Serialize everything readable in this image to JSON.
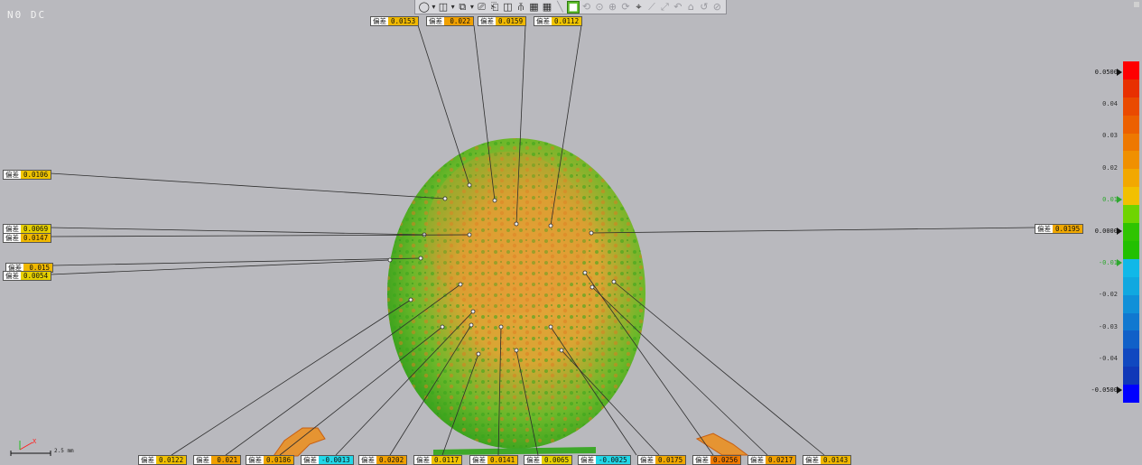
{
  "hud": {
    "text": "N0  DC"
  },
  "toolbar": {
    "buttons": [
      {
        "name": "view-sphere-icon",
        "glyph": "◯"
      },
      {
        "name": "dropdown-1-icon",
        "glyph": "▾",
        "small": true
      },
      {
        "name": "view-cube-icon",
        "glyph": "◫"
      },
      {
        "name": "dropdown-2-icon",
        "glyph": "▾",
        "small": true
      },
      {
        "name": "shade-icon",
        "glyph": "⧉"
      },
      {
        "name": "dropdown-3-icon",
        "glyph": "▾",
        "small": true
      },
      {
        "name": "front-view-icon",
        "glyph": "⎚"
      },
      {
        "name": "side-view-icon",
        "glyph": "⎗"
      },
      {
        "name": "split-view-icon",
        "glyph": "◫"
      },
      {
        "name": "align-icon",
        "glyph": "⫚"
      },
      {
        "name": "grid-table-icon",
        "glyph": "▦"
      },
      {
        "name": "grid-table-2-icon",
        "glyph": "▦"
      },
      {
        "name": "line-tool-icon",
        "glyph": "╲",
        "dim": true
      },
      {
        "name": "color-map-icon",
        "glyph": "■",
        "active": true
      },
      {
        "name": "rotate-icon",
        "glyph": "⟲",
        "dim": true
      },
      {
        "name": "zoom-icon",
        "glyph": "⊙",
        "dim": true
      },
      {
        "name": "pan-icon",
        "glyph": "⊕",
        "dim": true
      },
      {
        "name": "measure-icon",
        "glyph": "⟳",
        "dim": true
      },
      {
        "name": "probe-icon",
        "glyph": "⌖"
      },
      {
        "name": "section-icon",
        "glyph": "⟋",
        "dim": true
      },
      {
        "name": "fit-icon",
        "glyph": "⤢",
        "dim": true
      },
      {
        "name": "undo-icon",
        "glyph": "↶",
        "dim": true
      },
      {
        "name": "home-icon",
        "glyph": "⌂",
        "dim": true
      },
      {
        "name": "reset-icon",
        "glyph": "↺",
        "dim": true
      },
      {
        "name": "help-icon",
        "glyph": "⊘",
        "dim": true
      }
    ]
  },
  "labels": [
    {
      "key": "偏差",
      "value": "0.0153",
      "color": "#f0b800"
    },
    {
      "key": "偏差",
      "value": "0.022",
      "color": "#f0a000"
    },
    {
      "key": "偏差",
      "value": "0.0159",
      "color": "#f0b800"
    },
    {
      "key": "偏差",
      "value": "0.0112",
      "color": "#f0c400"
    },
    {
      "key": "偏差",
      "value": "0.0106",
      "color": "#f0c400"
    },
    {
      "key": "偏差",
      "value": "0.0069",
      "color": "#e6d000"
    },
    {
      "key": "偏差",
      "value": "0.0147",
      "color": "#f0b800"
    },
    {
      "key": "偏差",
      "value": "0.015",
      "color": "#f0b800"
    },
    {
      "key": "偏差",
      "value": "0.0054",
      "color": "#e6d000"
    },
    {
      "key": "偏差",
      "value": "0.0195",
      "color": "#f0a800"
    },
    {
      "key": "偏差",
      "value": "0.0122",
      "color": "#f0c000"
    },
    {
      "key": "偏差",
      "value": "0.021",
      "color": "#f0a000"
    },
    {
      "key": "偏差",
      "value": "0.0186",
      "color": "#f0a800"
    },
    {
      "key": "偏差",
      "value": "-0.0013",
      "color": "#22d8e8"
    },
    {
      "key": "偏差",
      "value": "0.0202",
      "color": "#f0a000"
    },
    {
      "key": "偏差",
      "value": "0.0117",
      "color": "#f0c400"
    },
    {
      "key": "偏差",
      "value": "0.0141",
      "color": "#f0b800"
    },
    {
      "key": "偏差",
      "value": "0.0065",
      "color": "#e6d000"
    },
    {
      "key": "偏差",
      "value": "-0.0025",
      "color": "#22d8e8"
    },
    {
      "key": "偏差",
      "value": "0.0175",
      "color": "#f0a800"
    },
    {
      "key": "偏差",
      "value": "0.0256",
      "color": "#ef7a00"
    },
    {
      "key": "偏差",
      "value": "0.0217",
      "color": "#f0a000"
    },
    {
      "key": "偏差",
      "value": "0.0143",
      "color": "#f0b800"
    }
  ],
  "legend": {
    "ticks": [
      {
        "text": "0.0500",
        "kind": "edge",
        "arrow": true
      },
      {
        "text": "0.04",
        "kind": ""
      },
      {
        "text": "0.03",
        "kind": ""
      },
      {
        "text": "0.02",
        "kind": ""
      },
      {
        "text": "0.01",
        "kind": "green",
        "arrow": true
      },
      {
        "text": "0.0000",
        "kind": "edge",
        "arrow": true
      },
      {
        "text": "-0.01",
        "kind": "green",
        "arrow": true
      },
      {
        "text": "-0.02",
        "kind": ""
      },
      {
        "text": "-0.03",
        "kind": ""
      },
      {
        "text": "-0.04",
        "kind": ""
      },
      {
        "text": "-0.0500",
        "kind": "edge",
        "arrow": true
      }
    ],
    "colors": [
      "#ff0000",
      "#e83000",
      "#ea4a00",
      "#ec6000",
      "#ee7800",
      "#f09000",
      "#f2a800",
      "#f2c000",
      "#6fd400",
      "#2fc400",
      "#22c000",
      "#10b8e8",
      "#10a8e0",
      "#1090d8",
      "#1078d0",
      "#1060c8",
      "#1048c0",
      "#1038b8",
      "#0000ff"
    ]
  },
  "scale_bar": {
    "text": "2.5 mm"
  }
}
